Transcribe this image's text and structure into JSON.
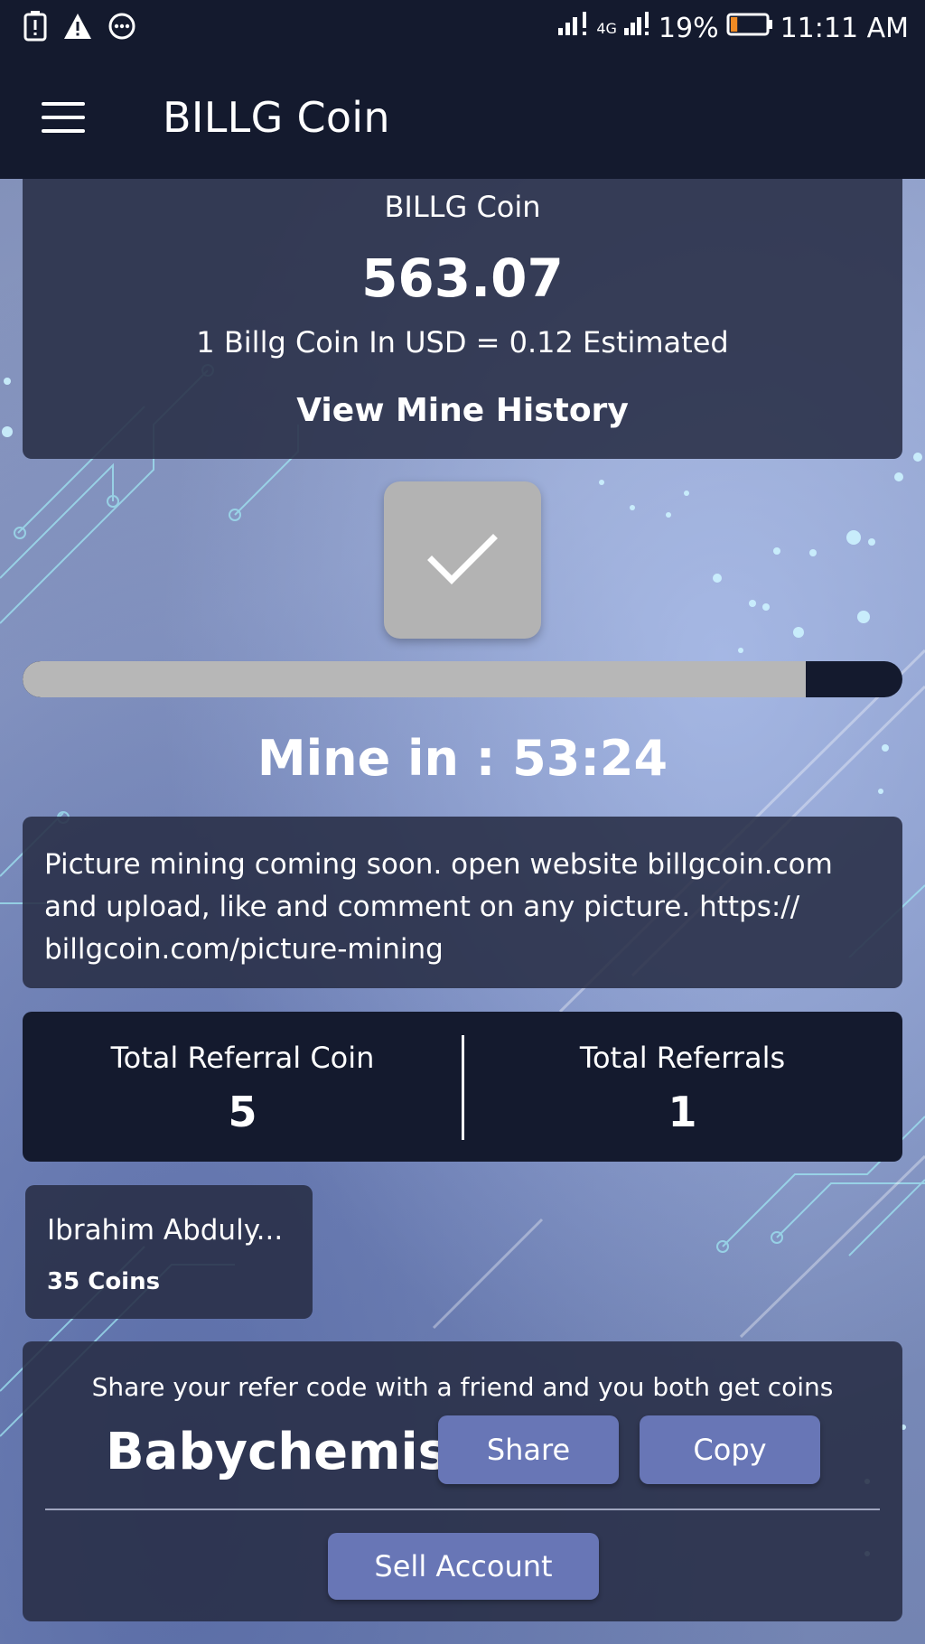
{
  "status_bar": {
    "signal_label": "4G",
    "battery": "19%",
    "time": "11:11 AM",
    "battery_level": 0.19,
    "icons": [
      "battery-alert-icon",
      "warning-icon",
      "more-circle-icon",
      "signal-icon",
      "battery-icon"
    ]
  },
  "app_bar": {
    "title": "BILLG Coin"
  },
  "balance": {
    "label": "BILLG Coin",
    "amount": "563.07",
    "rate": "1 Billg Coin In USD = 0.12 Estimated",
    "history_link": "View Mine History"
  },
  "mining": {
    "progress": 0.89,
    "timer": "Mine in : 53:24"
  },
  "notice": {
    "text": "Picture mining coming soon. open website billgcoin.com and upload, like and comment on any picture. https:// billgcoin.com/picture-mining"
  },
  "referrals": {
    "coin_label": "Total Referral Coin",
    "coin_value": "5",
    "count_label": "Total Referrals",
    "count_value": "1"
  },
  "referred_user": {
    "name": "Ibrahim Abduly...",
    "coins": "35 Coins"
  },
  "share": {
    "message": "Share your refer code with a friend and you both get coins",
    "code": "Babychemist",
    "share_label": "Share",
    "copy_label": "Copy",
    "sell_label": "Sell Account"
  },
  "colors": {
    "bar": "#141a2e",
    "card": "#282e46",
    "button": "#6876b6",
    "battery_low": "#f08a24"
  }
}
